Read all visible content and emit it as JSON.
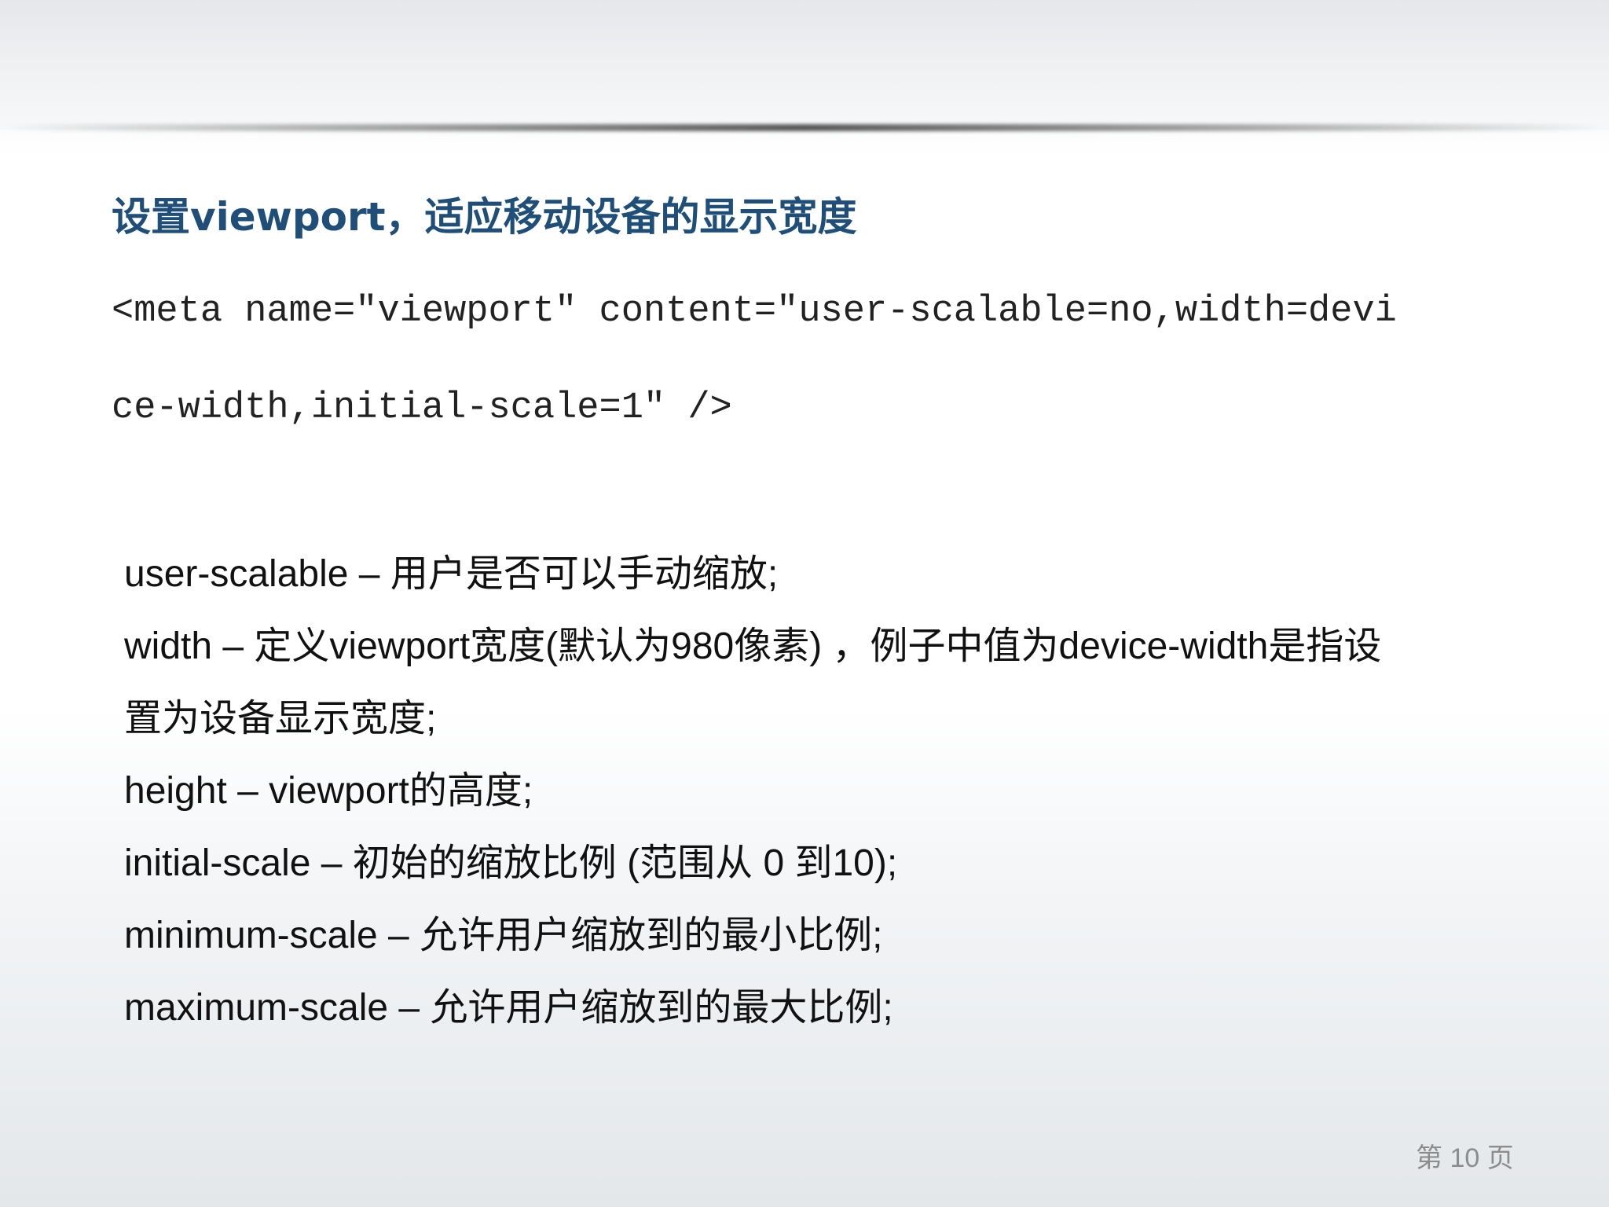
{
  "slide": {
    "title": "设置viewport，适应移动设备的显示宽度",
    "code_lines": [
      "<meta name=\"viewport\" content=\"user-scalable=no,width=devi",
      "ce-width,initial-scale=1\" />"
    ],
    "descriptions": [
      "user-scalable – 用户是否可以手动缩放;",
      "width – 定义viewport宽度(默认为980像素) ，例子中值为device-width是指设",
      "置为设备显示宽度;",
      "height – viewport的高度;",
      "initial-scale – 初始的缩放比例 (范围从 0 到10);",
      "minimum-scale – 允许用户缩放到的最小比例;",
      "maximum-scale – 允许用户缩放到的最大比例;"
    ],
    "page_number": "第 10 页"
  },
  "colors": {
    "title": "#1f4e79",
    "body_text": "#111111",
    "page_number": "#8c8c8c"
  }
}
